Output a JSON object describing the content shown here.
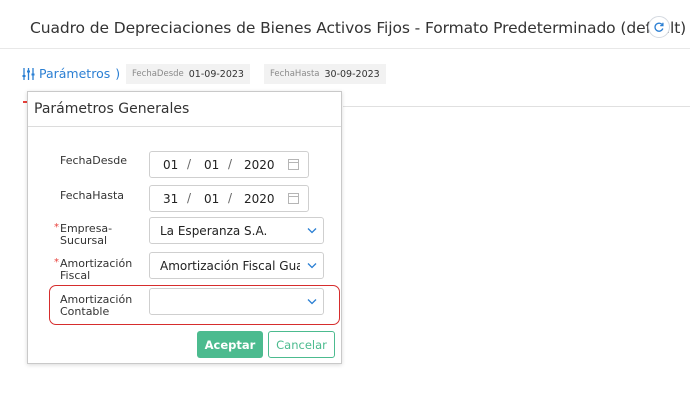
{
  "header": {
    "title": "Cuadro de Depreciaciones de Bienes Activos Fijos - Formato Predeterminado (default)"
  },
  "toolbar": {
    "params_label": "Parámetros",
    "params_suffix": ")",
    "chips": [
      {
        "key": "FechaDesde",
        "value": "01-09-2023"
      },
      {
        "key": "FechaHasta",
        "value": "30-09-2023"
      }
    ]
  },
  "popover": {
    "title": "Parámetros Generales",
    "fields": {
      "fecha_desde": {
        "label": "FechaDesde",
        "day": "01",
        "month": "01",
        "year": "2020"
      },
      "fecha_hasta": {
        "label": "FechaHasta",
        "day": "31",
        "month": "01",
        "year": "2020"
      },
      "empresa": {
        "label_1": "Empresa-",
        "label_2": "Sucursal",
        "value": "La Esperanza S.A.",
        "required": true
      },
      "amort_fiscal": {
        "label_1": "Amortización",
        "label_2": "Fiscal",
        "value": "Amortización Fiscal Gua",
        "required": true
      },
      "amort_contable": {
        "label_1": "Amortización",
        "label_2": "Contable",
        "value": ""
      }
    },
    "date_separator": "/",
    "required_mark": "*",
    "accept_label": "Aceptar",
    "cancel_label": "Cancelar"
  },
  "colors": {
    "accent_blue": "#2b7fd3",
    "green": "#4cbb8f",
    "required_red": "#e8413b",
    "highlight_red": "#d62d2d"
  },
  "icons": {
    "refresh": "refresh-icon",
    "sliders": "sliders-icon",
    "calendar": "calendar-icon",
    "chevron": "chevron-down-icon"
  }
}
